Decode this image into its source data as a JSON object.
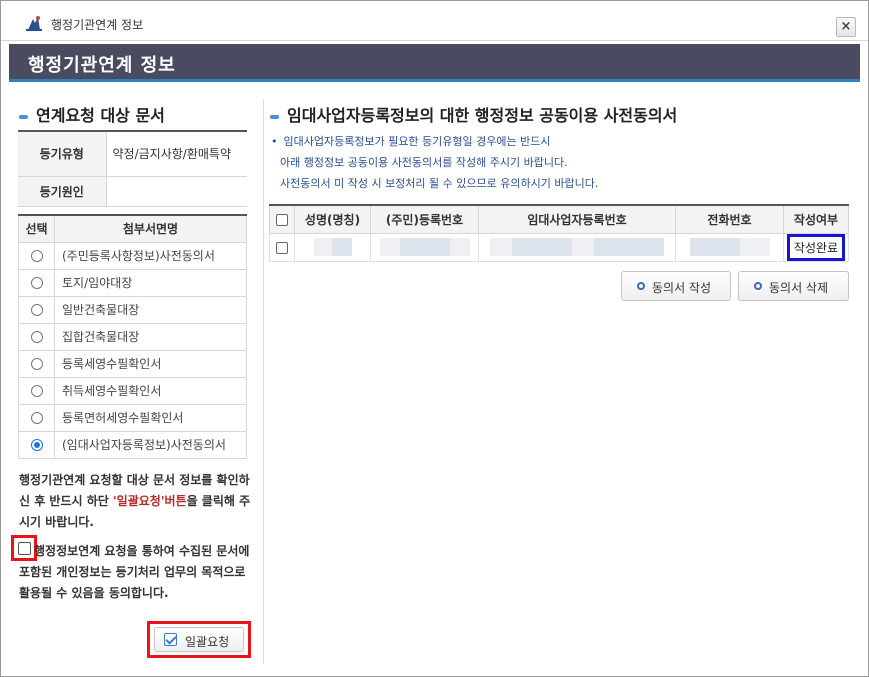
{
  "window": {
    "title": "행정기관연계 정보",
    "close_label": "×"
  },
  "header": {
    "title": "행정기관연계 정보"
  },
  "left": {
    "section_title": "연계요청 대상 문서",
    "info": [
      {
        "label": "등기유형",
        "value": "약정/금지사항/환매특약"
      },
      {
        "label": "등기원인",
        "value": ""
      }
    ],
    "doc_table": {
      "headers": [
        "선택",
        "첨부서면명"
      ],
      "rows": [
        {
          "name": "(주민등록사항정보)사전동의서",
          "selected": false
        },
        {
          "name": "토지/임야대장",
          "selected": false
        },
        {
          "name": "일반건축물대장",
          "selected": false
        },
        {
          "name": "집합건축물대장",
          "selected": false
        },
        {
          "name": "등록세영수필확인서",
          "selected": false
        },
        {
          "name": "취득세영수필확인서",
          "selected": false
        },
        {
          "name": "등록면허세영수필확인서",
          "selected": false
        },
        {
          "name": "(임대사업자등록정보)사전동의서",
          "selected": true
        }
      ]
    },
    "notice_part1": "행정기관연계 요청할 대상 문서 정보를 확인하신 후 반드시 하단 ",
    "notice_highlight": "'일괄요청'버튼",
    "notice_part2": "을 클릭해 주시기 바랍니다.",
    "agree_text": "행정정보연계 요청을 통하여 수집된 문서에 포함된 개인정보는 등기처리 업무의 목적으로 활용될 수 있음을 동의합니다.",
    "agree_checked": false,
    "bulk_button_label": "일괄요청"
  },
  "right": {
    "section_title": "임대사업자등록정보의 대한 행정정보 공동이용 사전동의서",
    "notes": [
      "임대사업자등록정보가 필요한 등기유형일 경우에는 반드시",
      "아래 행정정보 공동이용 사전동의서를 작성해 주시기 바랍니다.",
      "사전동의서 미 작성 시 보정처리 될 수 있으므로 유의하시기 바랍니다."
    ],
    "table": {
      "headers": [
        "성명(명칭)",
        "(주민)등록번호",
        "임대사업자등록번호",
        "전화번호",
        "작성여부"
      ],
      "rows": [
        {
          "status": "작성완료"
        }
      ]
    },
    "buttons": {
      "write": "동의서 작성",
      "delete": "동의서 삭제"
    }
  }
}
